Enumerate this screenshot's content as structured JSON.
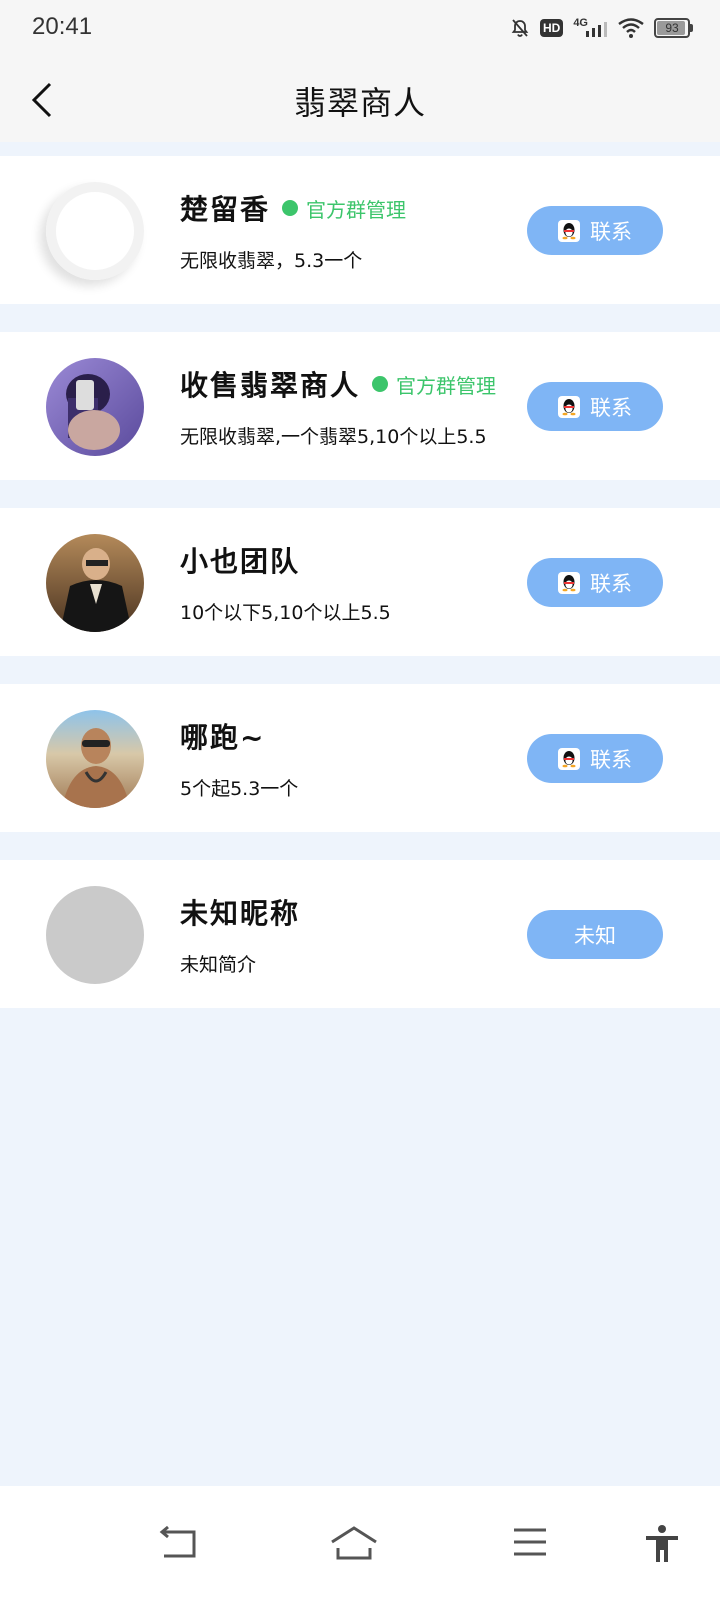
{
  "status": {
    "time": "20:41",
    "hd": "HD",
    "network": "4G",
    "battery": "93",
    "battery_level": 0.93
  },
  "header": {
    "title": "翡翠商人",
    "back_icon": "chevron-left-icon"
  },
  "merchants": [
    {
      "name": "楚留香",
      "tag": "官方群管理",
      "description": "无限收翡翠，5.3一个",
      "button": "联系",
      "avatar": "loading"
    },
    {
      "name": "收售翡翠商人",
      "tag": "官方群管理",
      "description": "无限收翡翠,一个翡翠5,10个以上5.5",
      "button": "联系",
      "avatar": "photo"
    },
    {
      "name": "小也团队",
      "tag": "",
      "description": "10个以下5,10个以上5.5",
      "button": "联系",
      "avatar": "photo"
    },
    {
      "name": "哪跑~",
      "tag": "",
      "description": "5个起5.3一个",
      "button": "联系",
      "avatar": "photo"
    },
    {
      "name": "未知昵称",
      "tag": "",
      "description": "未知简介",
      "button": "未知",
      "avatar": "placeholder"
    }
  ],
  "colors": {
    "accent_button": "#7fb5f5",
    "tag_green": "#3cc56b",
    "page_background": "#eef4fc"
  },
  "system_nav": [
    "back-icon",
    "home-icon",
    "menu-icon",
    "accessibility-icon"
  ]
}
